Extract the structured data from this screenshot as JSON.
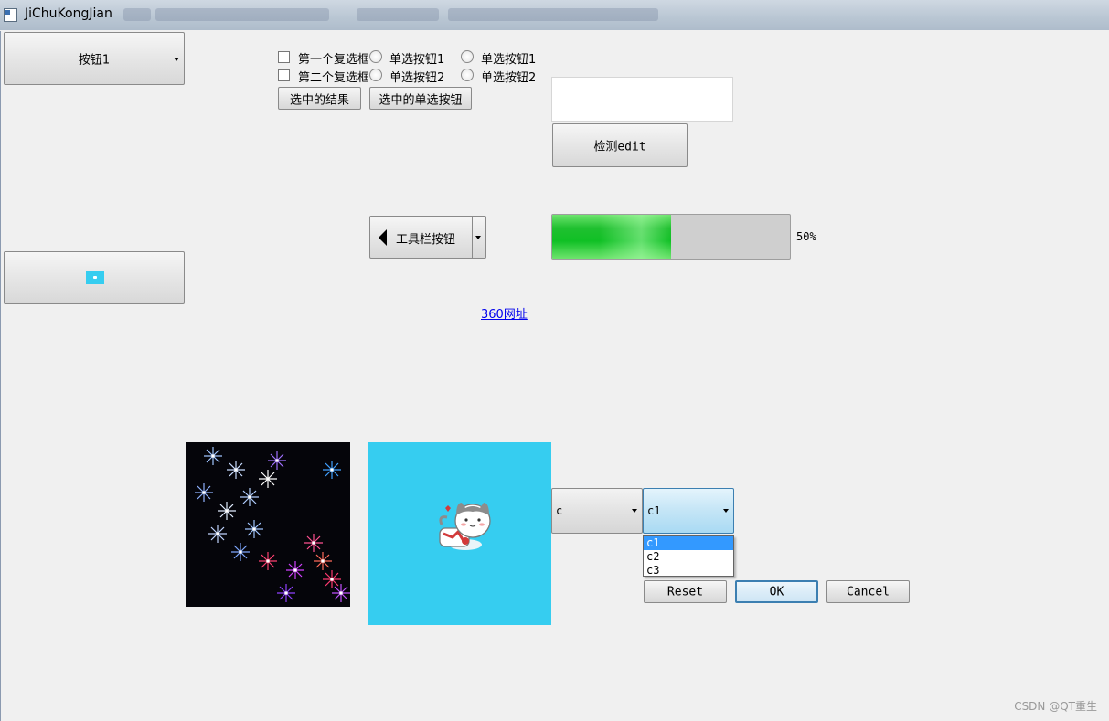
{
  "window": {
    "title": "JiChuKongJian"
  },
  "buttons": {
    "button1": "按钮1",
    "check_result": "选中的结果",
    "radio_result": "选中的单选按钮",
    "check_edit": "检测edit",
    "toolbar": "工具栏按钮",
    "reset": "Reset",
    "ok": "OK",
    "cancel": "Cancel"
  },
  "checkboxes": [
    {
      "label": "第一个复选框",
      "checked": false
    },
    {
      "label": "第二个复选框",
      "checked": false
    }
  ],
  "radios_group1": [
    {
      "label": "单选按钮1",
      "checked": false
    },
    {
      "label": "单选按钮2",
      "checked": false
    }
  ],
  "radios_group2": [
    {
      "label": "单选按钮1",
      "checked": false
    },
    {
      "label": "单选按钮2",
      "checked": false
    }
  ],
  "progress": {
    "value": 50,
    "text": "50%"
  },
  "link": {
    "text": "360网址"
  },
  "combo1": {
    "value": "c"
  },
  "combo2": {
    "value": "c1",
    "options": [
      "c1",
      "c2",
      "c3"
    ],
    "selected": "c1"
  },
  "footer": {
    "watermark": "CSDN @QT重生"
  },
  "colors": {
    "accent": "#3399ff",
    "progress_fill": "#10c025",
    "image_bg": "#36cdf0"
  }
}
